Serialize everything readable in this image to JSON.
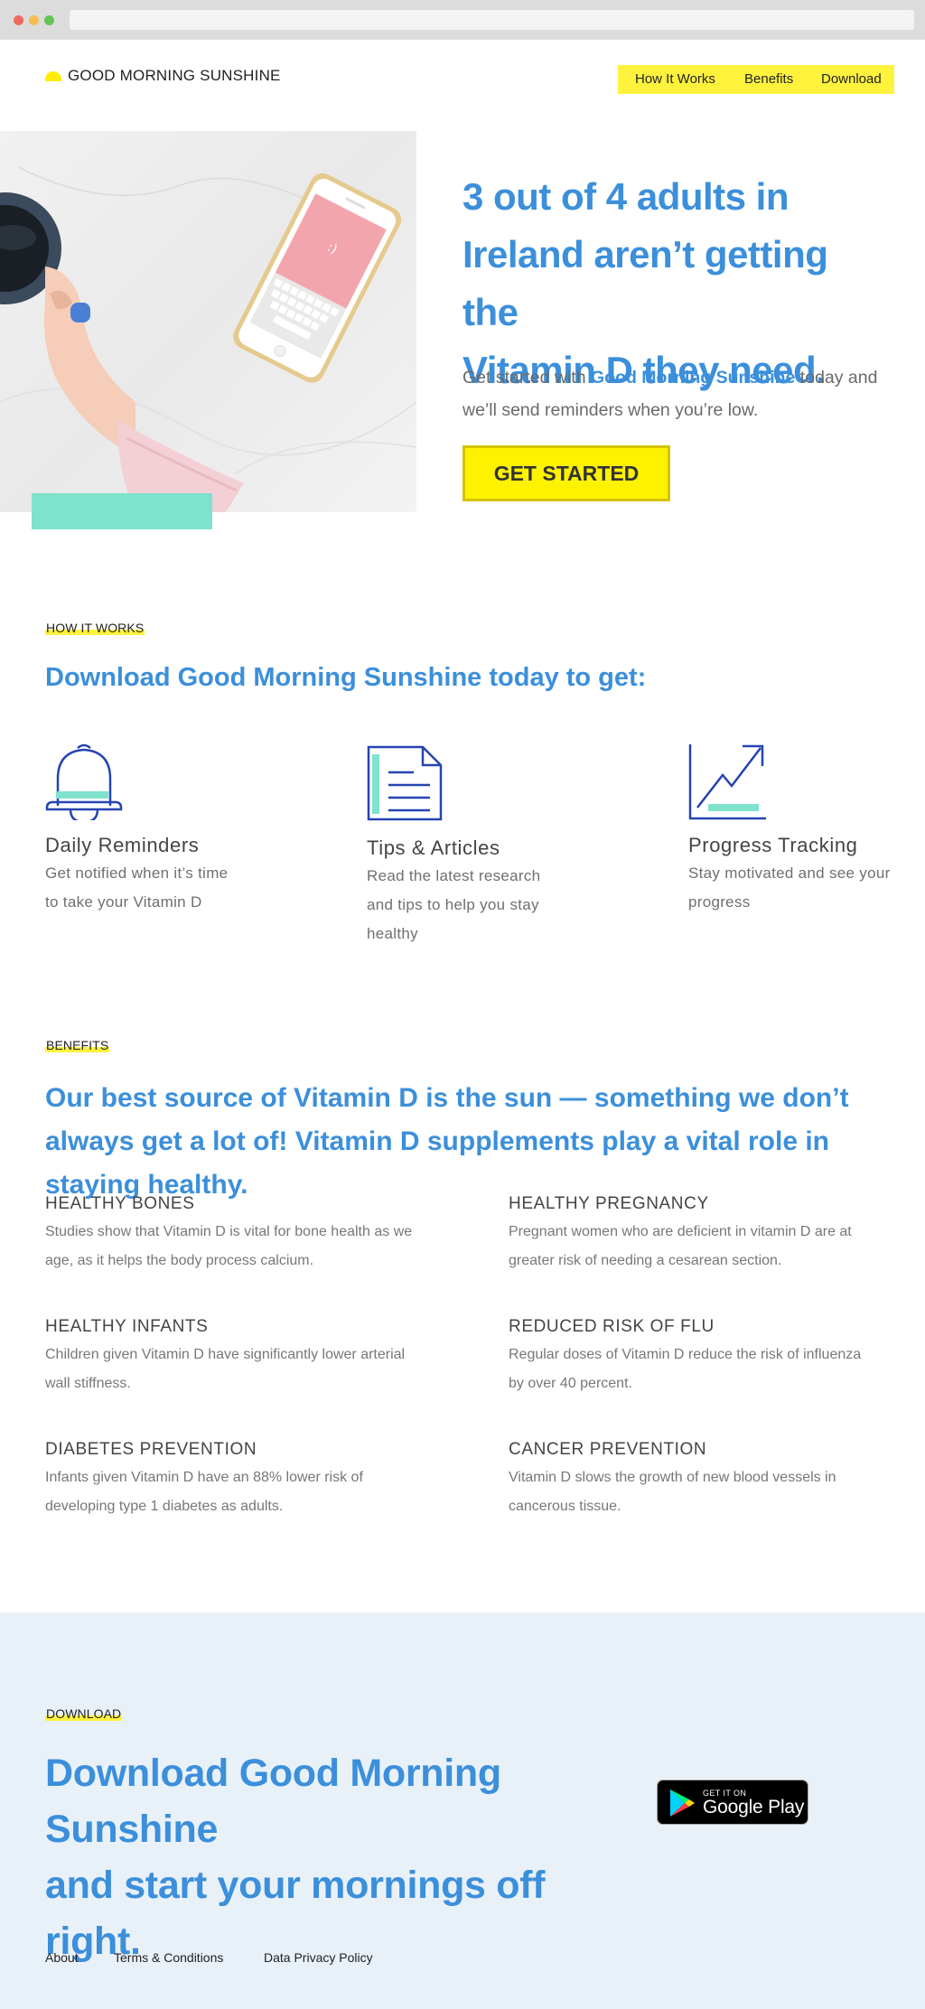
{
  "brand": {
    "name": "GOOD MORNING SUNSHINE",
    "yellow": "#fff23d",
    "blue": "#3b8fdb",
    "teal": "#7ee2cc"
  },
  "nav": {
    "items": [
      "How It Works",
      "Benefits",
      "Download"
    ]
  },
  "hero": {
    "title_line1": "3 out of 4 adults in",
    "title_line2": "Ireland aren’t getting the",
    "title_bold": "Vitamin D",
    "title_end": " they need.",
    "sub_start": "Get started with ",
    "sub_bold": "Good Morning Sunshine",
    "sub_end": " today and we’ll send reminders when you’re low.",
    "cta": "GET STARTED",
    "phone_face": ":)"
  },
  "how_it_works": {
    "label": "HOW IT WORKS",
    "title_start": "Download ",
    "title_bold": "Good Morning Sunshine",
    "title_end": " today to get:",
    "features": [
      {
        "icon": "bell-icon",
        "title": "Daily Reminders",
        "text": "Get notified when it’s time to take your Vitamin D"
      },
      {
        "icon": "document-icon",
        "title": "Tips & Articles",
        "text": "Read the latest research and tips to help you stay healthy"
      },
      {
        "icon": "chart-trend-icon",
        "title": "Progress Tracking",
        "text": "Stay motivated and see your progress"
      }
    ]
  },
  "benefits": {
    "label": "BENEFITS",
    "title": "Our best source of Vitamin D is the sun — something we don’t always get a lot of! Vitamin D supplements play a vital role in staying healthy.",
    "items": [
      {
        "title": "HEALTHY BONES",
        "text": "Studies show that Vitamin D is vital for bone health as we age, as it helps the body process calcium."
      },
      {
        "title": "HEALTHY PREGNANCY",
        "text": "Pregnant women who are deficient in vitamin D are at greater risk of needing a cesarean section."
      },
      {
        "title": "HEALTHY INFANTS",
        "text": "Children given Vitamin D have significantly lower arterial wall stiffness."
      },
      {
        "title": "REDUCED RISK OF FLU",
        "text": "Regular doses of Vitamin D reduce the risk of influenza by over 40 percent."
      },
      {
        "title": "DIABETES PREVENTION",
        "text": "Infants given Vitamin D have an 88% lower risk of developing type 1 diabetes as adults."
      },
      {
        "title": "CANCER PREVENTION",
        "text": "Vitamin D slows the growth of new blood vessels in cancerous tissue."
      }
    ]
  },
  "download": {
    "label": "DOWNLOAD",
    "title_start": "Download ",
    "title_bold": "Good Morning Sunshine",
    "title_end": "and start your mornings off right.",
    "store_small": "GET IT ON",
    "store_big": "Google Play"
  },
  "footer": {
    "links": [
      "About",
      "Terms & Conditions",
      "Data Privacy Policy"
    ]
  }
}
